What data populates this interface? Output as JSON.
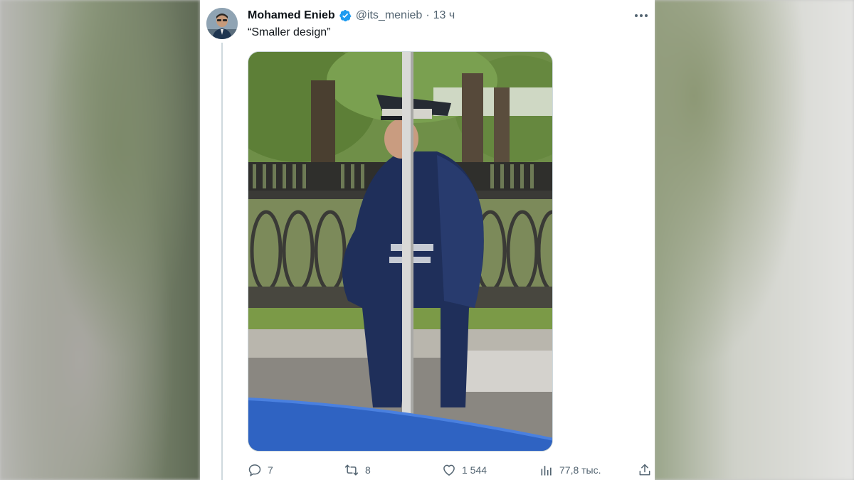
{
  "tweet": {
    "author_name": "Mohamed Enieb",
    "handle": "@its_menieb",
    "separator": "·",
    "time": "13 ч",
    "text": "“Smaller design”"
  },
  "actions": {
    "replies": "7",
    "retweets": "8",
    "likes": "1 544",
    "views": "77,8 тыс."
  },
  "icons": [
    "verified-badge-icon",
    "more-icon",
    "reply-icon",
    "retweet-icon",
    "like-icon",
    "views-icon",
    "share-icon"
  ],
  "colors": {
    "verified_blue": "#1d9bf0",
    "text_primary": "#0f1419",
    "text_secondary": "#536471",
    "divider": "#cfd9de"
  }
}
